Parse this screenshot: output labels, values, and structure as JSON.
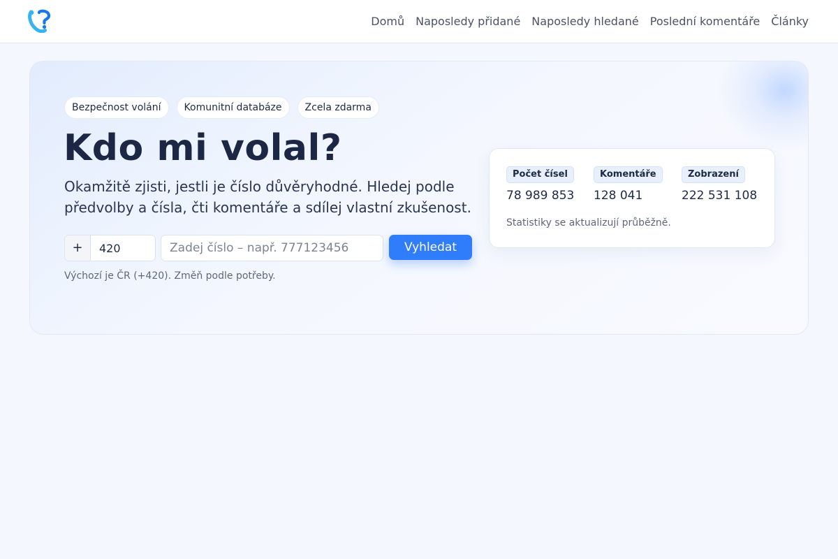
{
  "colors": {
    "accent": "#2f7dfa",
    "logo_light": "#36b4f2",
    "logo_dark": "#1879e8",
    "text": "#1e2a44",
    "muted": "#5f6778"
  },
  "nav": {
    "logo_icon": "phone-question-icon",
    "links": [
      "Domů",
      "Naposledy přidané",
      "Naposledy hledané",
      "Poslední komentáře",
      "Články"
    ]
  },
  "hero": {
    "chips": [
      "Bezpečnost volání",
      "Komunitní databáze",
      "Zcela zdarma"
    ],
    "title": "Kdo mi volal?",
    "subtitle": "Okamžitě zjisti, jestli je číslo důvěryhodné. Hledej podle předvolby a čísla, čti komentáře a sdílej vlastní zkušenost.",
    "search": {
      "prefix_symbol": "+",
      "prefix_value": "420",
      "number_placeholder": "Zadej číslo – např. 777123456",
      "button_label": "Vyhledat"
    },
    "hint": "Výchozí je ČR (+420). Změň podle potřeby."
  },
  "stats": {
    "items": [
      {
        "label": "Počet čísel",
        "value": "78 989 853"
      },
      {
        "label": "Komentáře",
        "value": "128 041"
      },
      {
        "label": "Zobrazení",
        "value": "222 531 108"
      }
    ],
    "note": "Statistiky se aktualizují průběžně."
  }
}
